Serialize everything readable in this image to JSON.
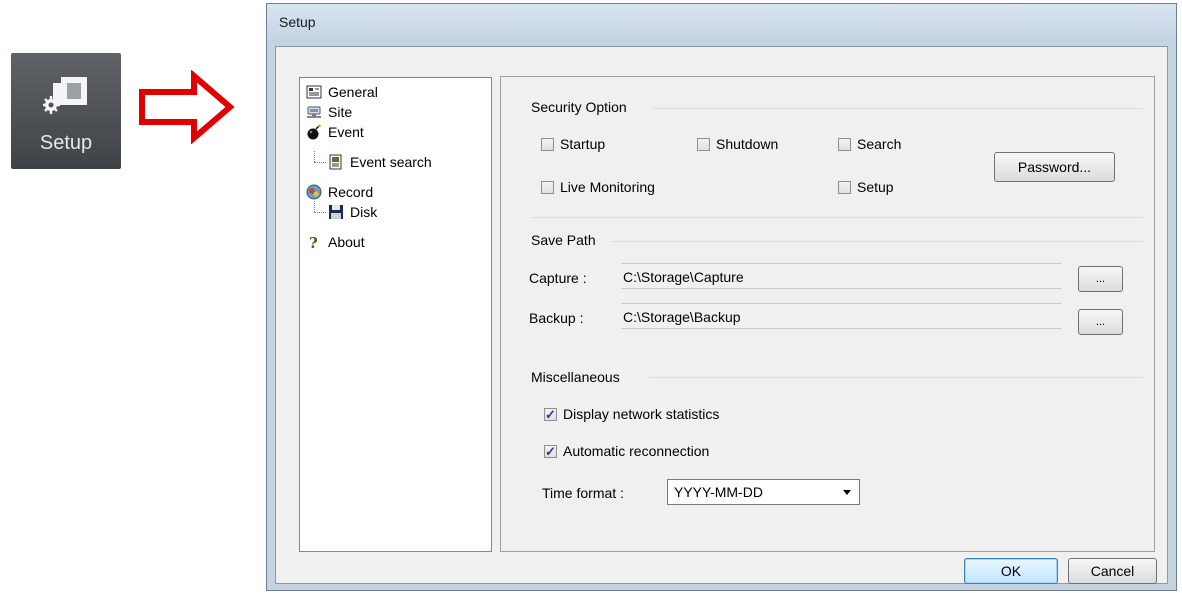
{
  "launcher": {
    "label": "Setup",
    "icon": "setup-gear-window-icon"
  },
  "window": {
    "title": "Setup"
  },
  "tree": {
    "items": [
      {
        "label": "General",
        "icon": "general-icon"
      },
      {
        "label": "Site",
        "icon": "site-icon"
      },
      {
        "label": "Event",
        "icon": "event-bomb-icon"
      },
      {
        "label": "Event search",
        "icon": "event-search-icon"
      },
      {
        "label": "Record",
        "icon": "record-icon"
      },
      {
        "label": "Disk",
        "icon": "disk-icon"
      },
      {
        "label": "About",
        "icon": "about-icon"
      }
    ]
  },
  "security": {
    "title": "Security Option",
    "startup": "Startup",
    "shutdown": "Shutdown",
    "search": "Search",
    "live_monitoring": "Live Monitoring",
    "setup": "Setup",
    "password_button": "Password..."
  },
  "save_path": {
    "title": "Save Path",
    "capture_label": "Capture :",
    "capture_value": "C:\\Storage\\Capture",
    "backup_label": "Backup :",
    "backup_value": "C:\\Storage\\Backup",
    "browse_label": "..."
  },
  "misc": {
    "title": "Miscellaneous",
    "display_network_statistics": "Display network statistics",
    "automatic_reconnection": "Automatic reconnection",
    "time_format_label": "Time format :",
    "time_format_value": "YYYY-MM-DD"
  },
  "footer": {
    "ok": "OK",
    "cancel": "Cancel"
  },
  "colors": {
    "arrow": "#e00000",
    "tile_bg": "#4f5256",
    "dialog_frame": "#c6d3e1"
  }
}
